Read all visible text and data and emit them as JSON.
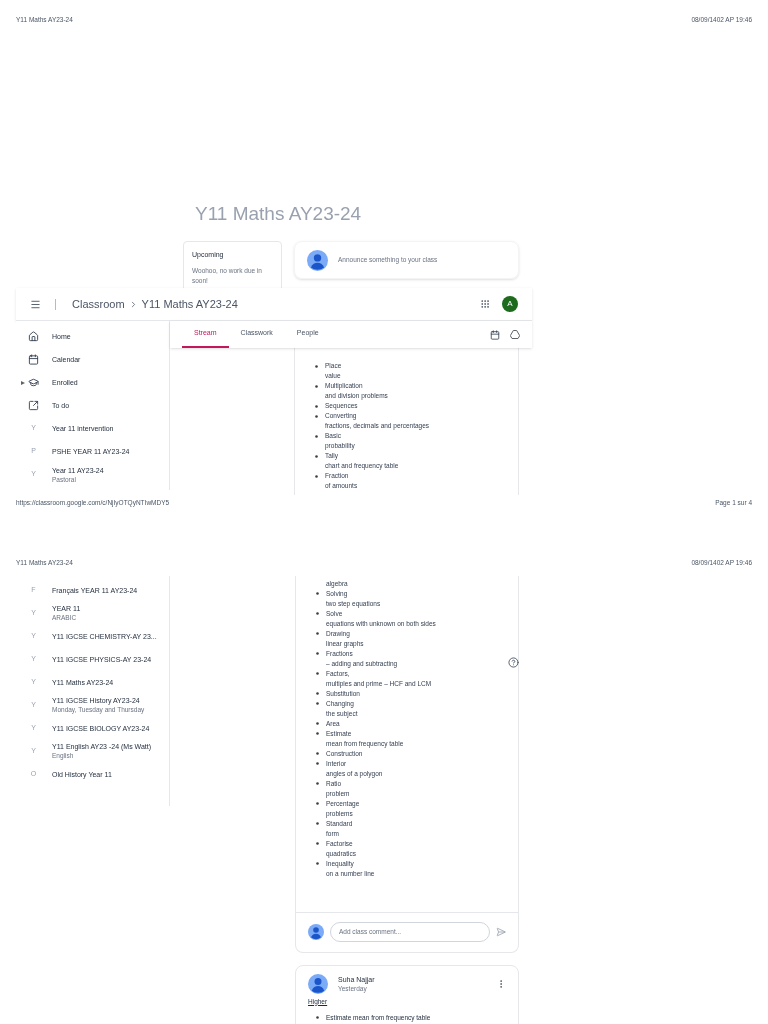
{
  "print_header_1": {
    "title": "Y11 Maths AY23-24",
    "date": "08/09/1402 AP 19:46"
  },
  "page_title": "Y11 Maths AY23-24",
  "upcoming": {
    "title": "Upcoming",
    "text": "Woohoo, no work due in soon!"
  },
  "announce": {
    "placeholder": "Announce something to your class"
  },
  "app_bar": {
    "brand": "Classroom",
    "class_name": "Y11 Maths AY23-24",
    "avatar": "A"
  },
  "tabs": [
    {
      "label": "Stream",
      "selected": true
    },
    {
      "label": "Classwork",
      "selected": false
    },
    {
      "label": "People",
      "selected": false
    }
  ],
  "sidebar_1": [
    {
      "kind": "home",
      "label": "Home"
    },
    {
      "kind": "calendar",
      "label": "Calendar"
    },
    {
      "kind": "enrolled",
      "label": "Enrolled",
      "expanded": false
    },
    {
      "kind": "todo",
      "label": "To do"
    },
    {
      "kind": "class",
      "initial": "Y",
      "label": "Year 11 intervention"
    },
    {
      "kind": "class",
      "initial": "P",
      "label": "PSHE YEAR 11 AY23-24"
    },
    {
      "kind": "class",
      "initial": "Y",
      "label": "Year 11 AY23-24",
      "subtitle": "Pastoral"
    }
  ],
  "topics_1": [
    {
      "head": "Place",
      "rest": "value"
    },
    {
      "head": "Multiplication",
      "rest": "and division problems"
    },
    {
      "head": "Sequences"
    },
    {
      "head": "Converting",
      "rest": "fractions, decimals and percentages"
    },
    {
      "head": "Basic",
      "rest": "probability"
    },
    {
      "head": "Tally",
      "rest": "chart and frequency table"
    },
    {
      "head": "Fraction",
      "rest": "of amounts"
    }
  ],
  "print_footer_1": {
    "url": "https://classroom.google.com/c/NjIyOTQyNTIwMDY5",
    "page": "Page 1 sur 4"
  },
  "print_header_2": {
    "title": "Y11 Maths AY23-24",
    "date": "08/09/1402 AP 19:46"
  },
  "sidebar_2": [
    {
      "kind": "class",
      "initial": "F",
      "label": "Français YEAR 11 AY23-24"
    },
    {
      "kind": "class",
      "initial": "Y",
      "label": "YEAR 11",
      "subtitle": "ARABIC"
    },
    {
      "kind": "class",
      "initial": "Y",
      "label": "Y11 IGCSE CHEMISTRY-AY 23..."
    },
    {
      "kind": "class",
      "initial": "Y",
      "label": "Y11 IGCSE PHYSICS-AY 23-24"
    },
    {
      "kind": "class",
      "initial": "Y",
      "label": "Y11 Maths AY23-24"
    },
    {
      "kind": "class",
      "initial": "Y",
      "label": "Y11 IGCSE History AY23-24",
      "subtitle": "Monday, Tuesday and Thursday"
    },
    {
      "kind": "class",
      "initial": "Y",
      "label": "Y11 IGCSE BIOLOGY AY23-24"
    },
    {
      "kind": "class",
      "initial": "Y",
      "label": "Y11 English AY23 -24 (Ms Watt)",
      "subtitle": "English"
    },
    {
      "kind": "class",
      "initial": "O",
      "label": "Old History Year 11"
    }
  ],
  "topics_2_continued": "algebra",
  "topics_2": [
    {
      "head": "Solving",
      "rest": "two step equations"
    },
    {
      "head": "Solve",
      "rest": "equations with unknown on both sides"
    },
    {
      "head": "Drawing",
      "rest": "linear graphs"
    },
    {
      "head": "Fractions",
      "rest": "– adding and subtracting"
    },
    {
      "head": "Factors,",
      "rest": "multiples and prime – HCF and LCM"
    },
    {
      "head": "Substitution"
    },
    {
      "head": "Changing",
      "rest": "the subject"
    },
    {
      "head": "Area"
    },
    {
      "head": "Estimate",
      "rest": "mean from frequency table"
    },
    {
      "head": "Construction"
    },
    {
      "head": "Interior",
      "rest": "angles of a polygon"
    },
    {
      "head": "Ratio",
      "rest": "problem"
    },
    {
      "head": "Percentage",
      "rest": "problems"
    },
    {
      "head": "Standard",
      "rest": "form"
    },
    {
      "head": "Factorise",
      "rest": "quadratics"
    },
    {
      "head": "Inequality",
      "rest": "on a number line"
    }
  ],
  "comment": {
    "placeholder": "Add class comment..."
  },
  "post_2": {
    "author": "Suha Najjar",
    "time": "Yesterday",
    "heading": "Higher",
    "items": [
      "Estimate mean from frequency table"
    ]
  }
}
